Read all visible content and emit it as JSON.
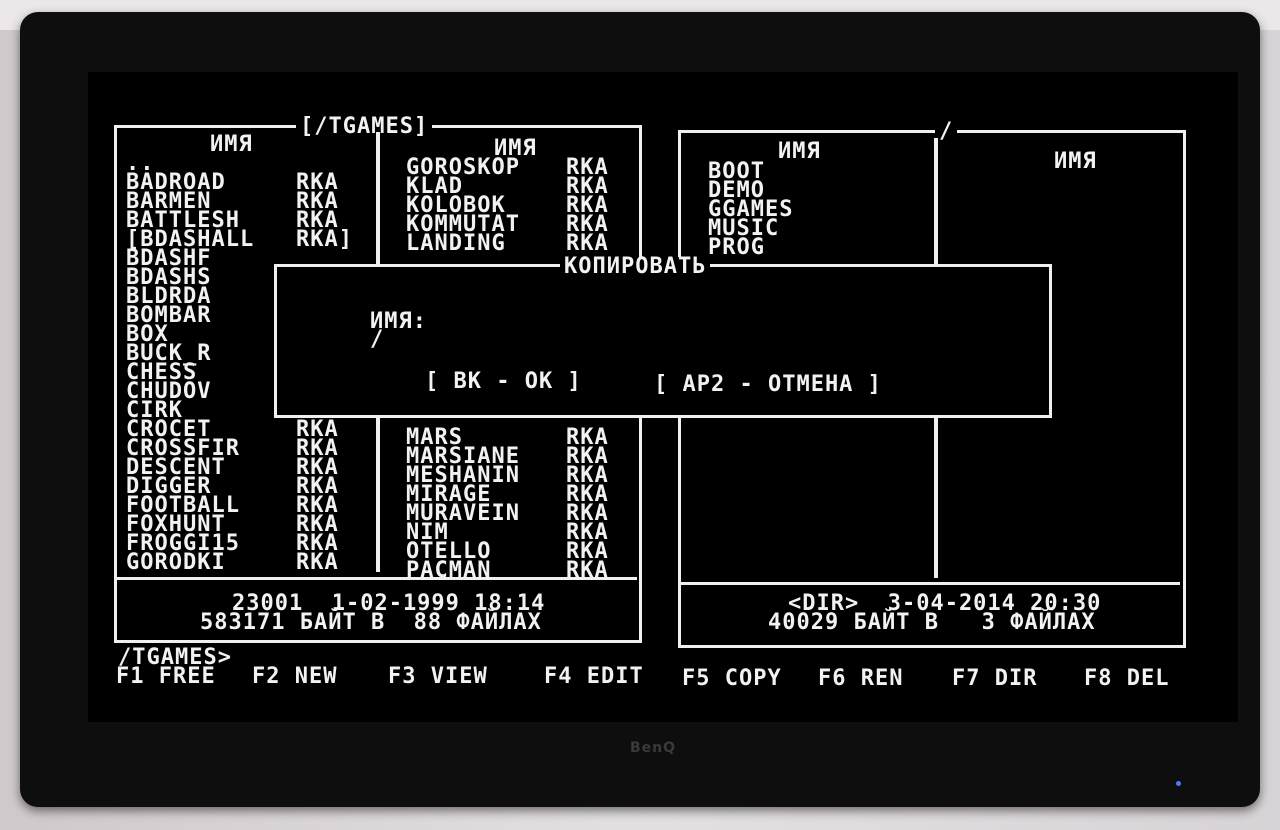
{
  "left_panel": {
    "title": "[/TGAMES]",
    "col_header": "ИМЯ",
    "col1": [
      {
        "name": "..",
        "ext": ""
      },
      {
        "name": "BADROAD",
        "ext": "RKA"
      },
      {
        "name": "BARMEN",
        "ext": "RKA"
      },
      {
        "name": "BATTLESH",
        "ext": "RKA"
      },
      {
        "name": "[BDASHALL",
        "ext": "RKA]"
      },
      {
        "name": "BDASHF",
        "ext": ""
      },
      {
        "name": "BDASHS",
        "ext": ""
      },
      {
        "name": "BLDRDA",
        "ext": ""
      },
      {
        "name": "BOMBAR",
        "ext": ""
      },
      {
        "name": "BOX",
        "ext": ""
      },
      {
        "name": "BUCK_R",
        "ext": ""
      },
      {
        "name": "CHESS",
        "ext": ""
      },
      {
        "name": "CHUDOV",
        "ext": ""
      },
      {
        "name": "CIRK",
        "ext": ""
      },
      {
        "name": "CROCET",
        "ext": "RKA"
      },
      {
        "name": "CROSSFIR",
        "ext": "RKA"
      },
      {
        "name": "DESCENT",
        "ext": "RKA"
      },
      {
        "name": "DIGGER",
        "ext": "RKA"
      },
      {
        "name": "FOOTBALL",
        "ext": "RKA"
      },
      {
        "name": "FOXHUNT",
        "ext": "RKA"
      },
      {
        "name": "FROGGI15",
        "ext": "RKA"
      },
      {
        "name": "GORODKI",
        "ext": "RKA"
      }
    ],
    "col2_top": [
      {
        "name": "GOROSKOP",
        "ext": "RKA"
      },
      {
        "name": "KLAD",
        "ext": "RKA"
      },
      {
        "name": "KOLOBOK",
        "ext": "RKA"
      },
      {
        "name": "KOMMUTAT",
        "ext": "RKA"
      },
      {
        "name": "LANDING",
        "ext": "RKA"
      }
    ],
    "col2_bottom": [
      {
        "name": "MARS",
        "ext": "RKA"
      },
      {
        "name": "MARSIANE",
        "ext": "RKA"
      },
      {
        "name": "MESHANIN",
        "ext": "RKA"
      },
      {
        "name": "MIRAGE",
        "ext": "RKA"
      },
      {
        "name": "MURAVEIN",
        "ext": "RKA"
      },
      {
        "name": "NIM",
        "ext": "RKA"
      },
      {
        "name": "OTELLO",
        "ext": "RKA"
      },
      {
        "name": "PACMAN",
        "ext": "RKA"
      }
    ],
    "info_line1": "23001  1-02-1999 18:14",
    "info_line2": "583171 БАЙТ В  88 ФАЙЛАХ"
  },
  "right_panel": {
    "title": "/",
    "col_header": "ИМЯ",
    "col1": [
      "BOOT",
      "DEMO",
      "GGAMES",
      "MUSIC",
      "PROG"
    ],
    "info_line1": "<DIR>  3-04-2014 20:30",
    "info_line2": "40029 БАЙТ В   3 ФАЙЛАХ"
  },
  "dialog": {
    "title": "КОПИРОВАТЬ",
    "label": "ИМЯ:",
    "input_value": "/",
    "ok_button": "[ ВК - ОК ]",
    "cancel_button": "[ АР2 - ОТМЕНА ]"
  },
  "command_line": "/TGAMES>",
  "function_keys": [
    {
      "key": "F1",
      "label": "FREE"
    },
    {
      "key": "F2",
      "label": "NEW"
    },
    {
      "key": "F3",
      "label": "VIEW"
    },
    {
      "key": "F4",
      "label": "EDIT"
    },
    {
      "key": "F5",
      "label": "COPY"
    },
    {
      "key": "F6",
      "label": "REN"
    },
    {
      "key": "F7",
      "label": "DIR"
    },
    {
      "key": "F8",
      "label": "DEL"
    }
  ],
  "monitor_brand": "BenQ"
}
